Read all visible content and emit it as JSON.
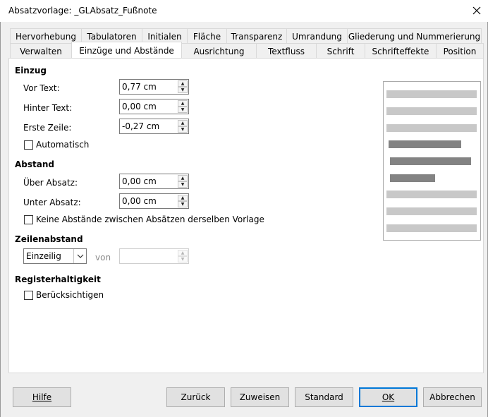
{
  "window": {
    "title": "Absatzvorlage: _GLAbsatz_Fußnote",
    "close_glyph": "✕"
  },
  "tabs_row1": [
    "Hervorhebung",
    "Tabulatoren",
    "Initialen",
    "Fläche",
    "Transparenz",
    "Umrandung",
    "Gliederung und Nummerierung"
  ],
  "tabs_row2": [
    "Verwalten",
    "Einzüge und Abstände",
    "Ausrichtung",
    "Textfluss",
    "Schrift",
    "Schrifteffekte",
    "Position"
  ],
  "active_tab": "Einzüge und Abstände",
  "einzug": {
    "heading": "Einzug",
    "vor_text": {
      "label": "Vor Text:",
      "value": "0,77 cm"
    },
    "hinter_text": {
      "label": "Hinter Text:",
      "value": "0,00 cm"
    },
    "erste_zeile": {
      "label": "Erste Zeile:",
      "value": "-0,27 cm"
    },
    "automatisch": {
      "label": "Automatisch",
      "checked": false
    }
  },
  "abstand": {
    "heading": "Abstand",
    "ueber_absatz": {
      "label": "Über Absatz:",
      "value": "0,00 cm"
    },
    "unter_absatz": {
      "label": "Unter Absatz:",
      "value": "0,00 cm"
    },
    "keine_abstaende": {
      "label": "Keine Abstände zwischen Absätzen derselben Vorlage",
      "checked": false
    }
  },
  "zeilenabstand": {
    "heading": "Zeilenabstand",
    "mode": "Einzeilig",
    "von_label": "von",
    "von_value": ""
  },
  "register": {
    "heading": "Registerhaltigkeit",
    "beruecksichtigen": {
      "label": "Berücksichtigen",
      "checked": false
    }
  },
  "buttons": {
    "hilfe": "Hilfe",
    "zurueck": "Zurück",
    "zuweisen": "Zuweisen",
    "standard": "Standard",
    "ok": "OK",
    "abbrechen": "Abbrechen"
  },
  "colors": {
    "preview_light": "#c8c8c8",
    "preview_dark": "#838383",
    "default_button_border": "#0078d7"
  }
}
